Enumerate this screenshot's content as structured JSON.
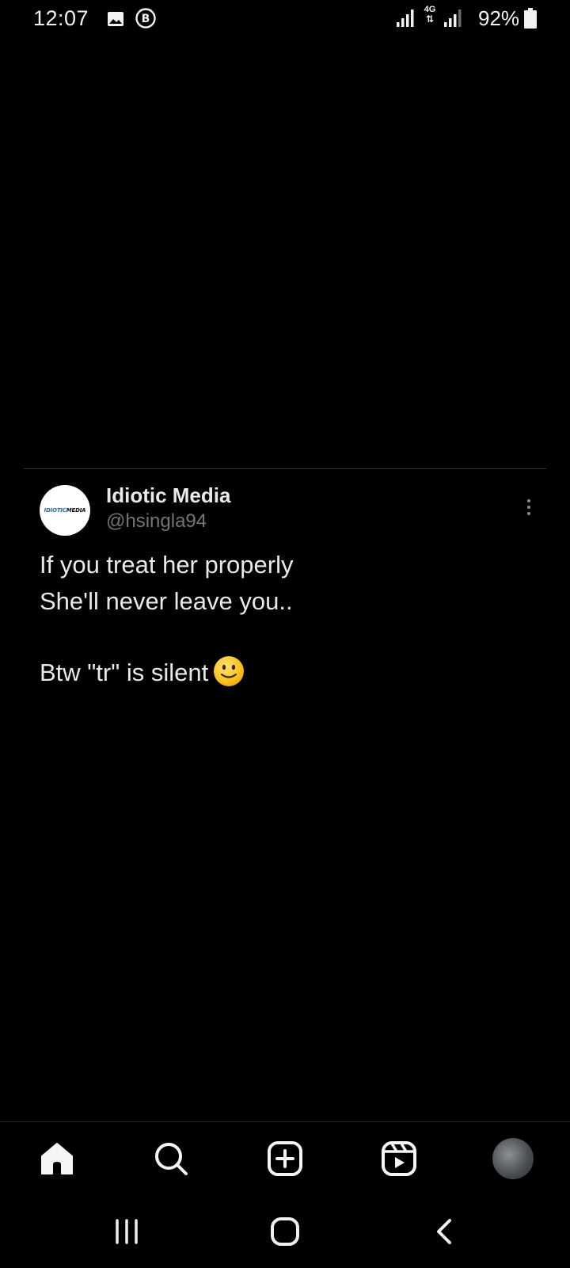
{
  "status_bar": {
    "time": "12:07",
    "network_type": "4G",
    "battery_percent": "92%",
    "icons": [
      "gallery-icon",
      "b-circle-icon",
      "signal-icon",
      "network-4g-icon",
      "signal-icon",
      "battery-icon"
    ]
  },
  "tweet": {
    "display_name": "Idiotic Media",
    "handle": "@hsingla94",
    "avatar_logo_text_1": "IDIOTIC",
    "avatar_logo_text_2": "MEDIA",
    "lines": [
      "If you treat her properly",
      "She'll never leave you..",
      "Btw \"tr\" is silent"
    ],
    "emoji": "slightly-smiling-face"
  },
  "bottom_nav": {
    "items": [
      {
        "name": "home",
        "icon": "home-icon",
        "active": true
      },
      {
        "name": "search",
        "icon": "search-icon"
      },
      {
        "name": "create",
        "icon": "plus-square-icon"
      },
      {
        "name": "reels",
        "icon": "reels-icon"
      },
      {
        "name": "profile",
        "icon": "profile-avatar"
      }
    ]
  },
  "system_nav": {
    "buttons": [
      "recents-icon",
      "home-button-icon",
      "back-icon"
    ]
  },
  "colors": {
    "background": "#000000",
    "text_primary": "#e7e9ea",
    "text_secondary": "#71767b",
    "divider": "#2f3336"
  }
}
